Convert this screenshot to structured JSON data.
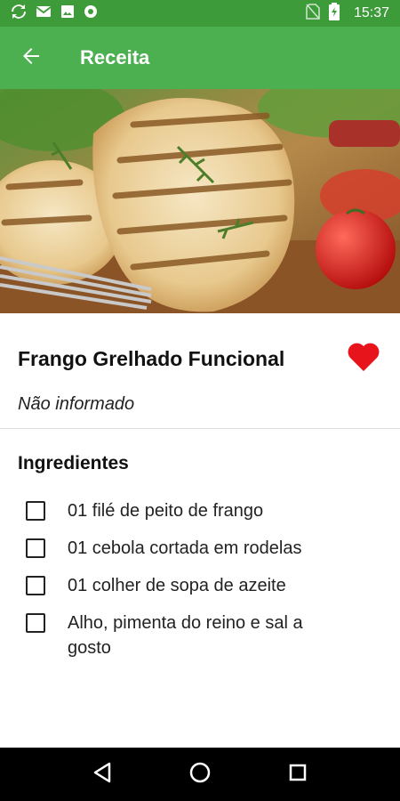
{
  "status_bar": {
    "time": "15:37",
    "left_icons": [
      "sync-icon",
      "gmail-icon",
      "image-icon",
      "circle-app-icon"
    ],
    "right_icons": [
      "no-sim-icon",
      "battery-charging-icon"
    ]
  },
  "app_bar": {
    "title": "Receita",
    "back_icon": "arrow-back-icon",
    "color": "#4caf50",
    "status_color": "#3e9b3a"
  },
  "recipe": {
    "title": "Frango Grelhado Funcional",
    "subtitle": "Não informado",
    "favorite": true,
    "favorite_color": "#e8141c",
    "image_alt_icon": "grilled-chicken-photo"
  },
  "ingredients_section": {
    "title": "Ingredientes",
    "items": [
      {
        "label": "01 filé de peito de frango",
        "checked": false
      },
      {
        "label": "01 cebola cortada em rodelas",
        "checked": false
      },
      {
        "label": "01 colher de sopa de azeite",
        "checked": false
      },
      {
        "label": "Alho, pimenta do reino e sal a gosto",
        "checked": false
      }
    ]
  },
  "nav_bar": {
    "buttons": [
      "back-triangle-icon",
      "home-circle-icon",
      "recents-square-icon"
    ]
  }
}
